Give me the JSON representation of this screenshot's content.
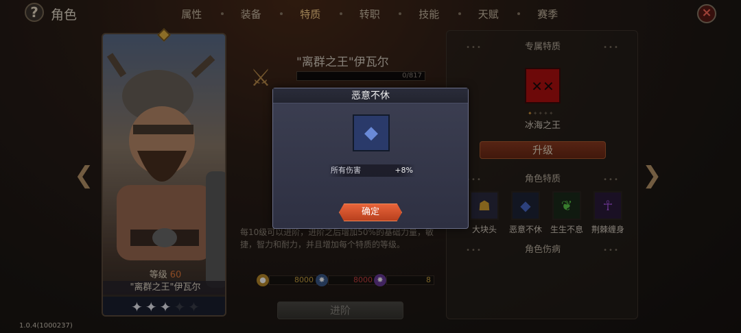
{
  "header": {
    "help_symbol": "?",
    "title": "角色",
    "tabs": [
      {
        "label": "属性"
      },
      {
        "label": "装备"
      },
      {
        "label": "特质"
      },
      {
        "label": "转职"
      },
      {
        "label": "技能"
      },
      {
        "label": "天赋"
      },
      {
        "label": "赛季"
      }
    ],
    "active_tab_index": 2,
    "close_symbol": "×"
  },
  "hero": {
    "level_label": "等级",
    "level_value": "60",
    "name": "\"离群之王\"伊瓦尔",
    "stars_lit": 3,
    "stars_total": 5
  },
  "trait": {
    "name": "\"离群之王\"伊瓦尔",
    "exp_text": "0/817",
    "exp_progress": 0,
    "description": "每10级可以进阶，进阶之后增加50%的基础力量，敏捷，智力和耐力，并且增加每个特质的等级。",
    "resources": [
      {
        "icon": "gold-coin-icon",
        "value": "8000",
        "color": "#c8a040"
      },
      {
        "icon": "blue-crystal-icon",
        "value": "8000",
        "color": "#c84040"
      },
      {
        "icon": "purple-crystal-icon",
        "value": "8",
        "color": "#c8a040"
      }
    ],
    "advance_label": "进阶"
  },
  "right_panel": {
    "exclusive_title": "专属特质",
    "exclusive_name": "冰海之王",
    "exclusive_stars_lit": 1,
    "exclusive_stars_total": 5,
    "upgrade_label": "升级",
    "traits_title": "角色特质",
    "traits": [
      {
        "name": "大块头",
        "icon": "big-guy-icon",
        "color": "#d4a030",
        "bg": "#2a2a40"
      },
      {
        "name": "恶意不休",
        "icon": "blue-shard-icon",
        "color": "#4a6ac8",
        "bg": "#1e2438"
      },
      {
        "name": "生生不息",
        "icon": "green-sprout-icon",
        "color": "#5ac84a",
        "bg": "#1a2a1a"
      },
      {
        "name": "荆棘缠身",
        "icon": "purple-figure-icon",
        "color": "#a050d8",
        "bg": "#2a1a3a"
      }
    ],
    "injury_title": "角色伤病"
  },
  "modal": {
    "title": "恶意不休",
    "stat_label": "所有伤害",
    "stat_value": "+8%",
    "confirm_label": "确定"
  },
  "footer": {
    "version": "1.0.4(1000237)"
  }
}
